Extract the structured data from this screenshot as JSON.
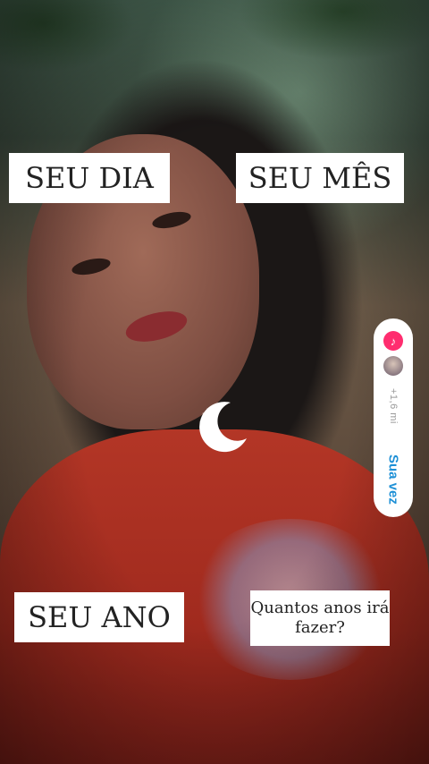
{
  "labels": {
    "day": "SEU DIA",
    "month": "SEU MÊS",
    "year": "SEU ANO",
    "question": "Quantos anos irá fazer?"
  },
  "side_panel": {
    "count": "+1,6 mi",
    "cta": "Sua vez",
    "tiktok_icon": "tiktok-music-note-icon"
  },
  "decor": {
    "center_icon": "crescent-moon-sparkle-icon"
  },
  "colors": {
    "label_bg": "#ffffff",
    "cta": "#1e90d6",
    "badge": "#ff2d6f"
  }
}
